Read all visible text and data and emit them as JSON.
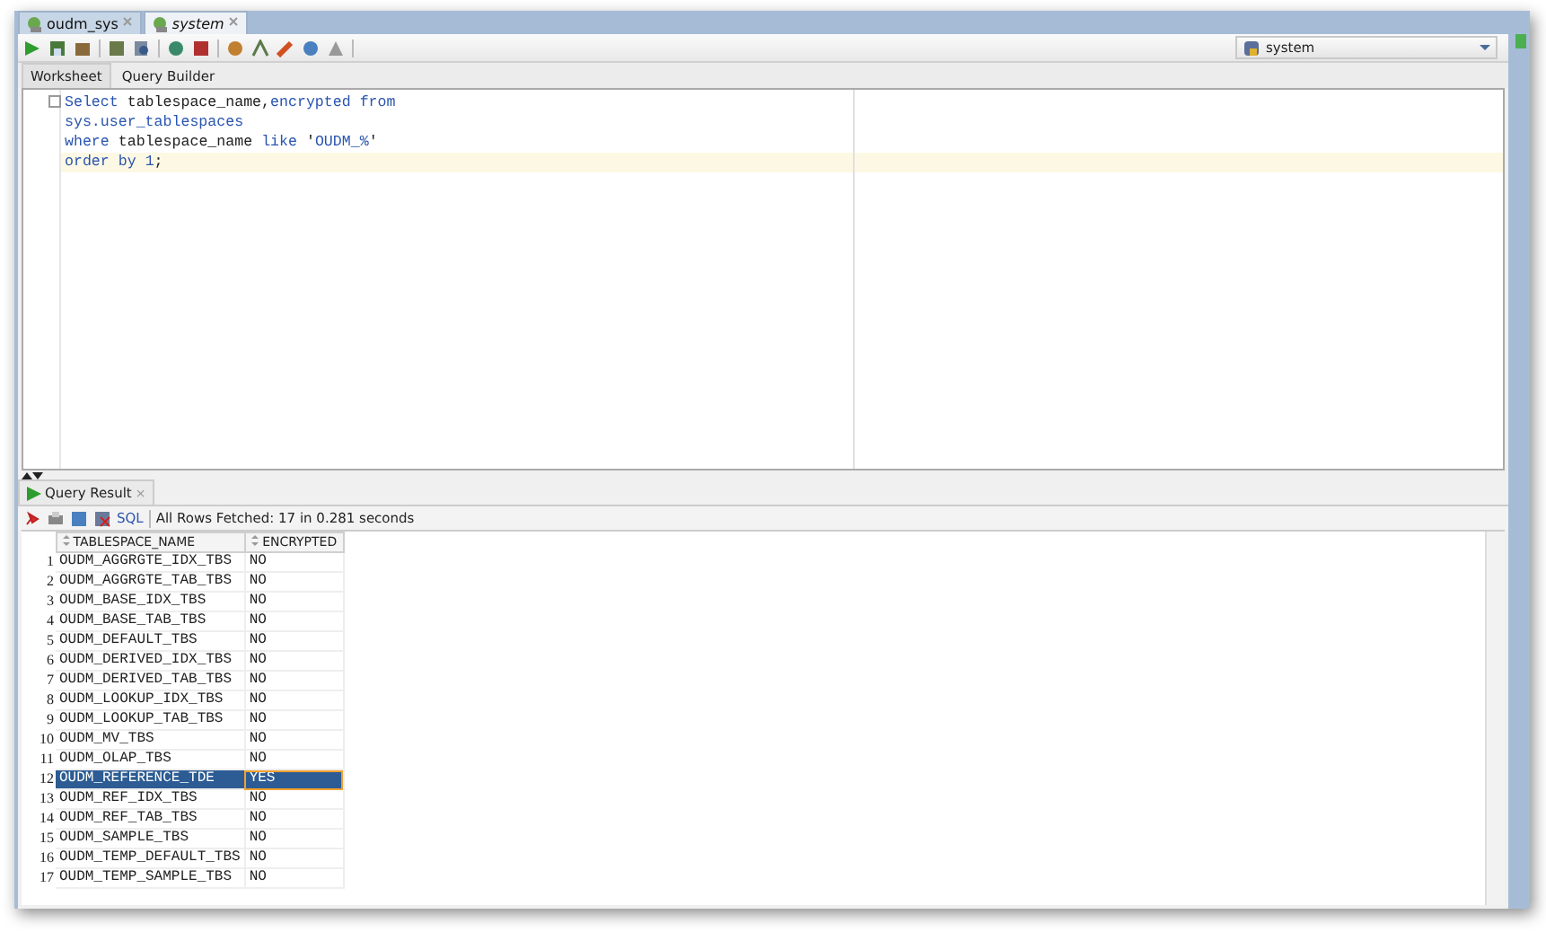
{
  "doc_tabs": [
    {
      "label": "oudm_sys",
      "selected": false
    },
    {
      "label": "system",
      "selected": true
    }
  ],
  "connection": {
    "value": "system"
  },
  "editor_tabs": [
    {
      "label": "Worksheet",
      "selected": true
    },
    {
      "label": "Query Builder",
      "selected": false
    }
  ],
  "code_lines": [
    {
      "current": false,
      "tokens": [
        {
          "kind": "keyword",
          "text": "Select"
        },
        {
          "kind": "plain",
          "text": " tablespace_name,"
        },
        {
          "kind": "keyword",
          "text": "encrypted from"
        }
      ]
    },
    {
      "current": false,
      "tokens": [
        {
          "kind": "keyword",
          "text": "sys.user_tablespaces"
        }
      ]
    },
    {
      "current": false,
      "tokens": [
        {
          "kind": "keyword",
          "text": "where"
        },
        {
          "kind": "plain",
          "text": " tablespace_name "
        },
        {
          "kind": "keyword",
          "text": "like"
        },
        {
          "kind": "plain",
          "text": " '"
        },
        {
          "kind": "string",
          "text": "OUDM_%"
        },
        {
          "kind": "plain",
          "text": "'"
        }
      ]
    },
    {
      "current": true,
      "tokens": [
        {
          "kind": "keyword",
          "text": "order by "
        },
        {
          "kind": "string",
          "text": "1"
        },
        {
          "kind": "plain",
          "text": ";"
        }
      ]
    }
  ],
  "result_tab": {
    "label": "Query Result",
    "close": "×"
  },
  "result_toolbar": {
    "sql_link": "SQL",
    "status": "All Rows Fetched: 17 in 0.281 seconds"
  },
  "table": {
    "columns": [
      "TABLESPACE_NAME",
      "ENCRYPTED"
    ],
    "rows": [
      {
        "num": "1",
        "cells": [
          "OUDM_AGGRGTE_IDX_TBS",
          "NO"
        ],
        "selected": false
      },
      {
        "num": "2",
        "cells": [
          "OUDM_AGGRGTE_TAB_TBS",
          "NO"
        ],
        "selected": false
      },
      {
        "num": "3",
        "cells": [
          "OUDM_BASE_IDX_TBS",
          "NO"
        ],
        "selected": false
      },
      {
        "num": "4",
        "cells": [
          "OUDM_BASE_TAB_TBS",
          "NO"
        ],
        "selected": false
      },
      {
        "num": "5",
        "cells": [
          "OUDM_DEFAULT_TBS",
          "NO"
        ],
        "selected": false
      },
      {
        "num": "6",
        "cells": [
          "OUDM_DERIVED_IDX_TBS",
          "NO"
        ],
        "selected": false
      },
      {
        "num": "7",
        "cells": [
          "OUDM_DERIVED_TAB_TBS",
          "NO"
        ],
        "selected": false
      },
      {
        "num": "8",
        "cells": [
          "OUDM_LOOKUP_IDX_TBS",
          "NO"
        ],
        "selected": false
      },
      {
        "num": "9",
        "cells": [
          "OUDM_LOOKUP_TAB_TBS",
          "NO"
        ],
        "selected": false
      },
      {
        "num": "10",
        "cells": [
          "OUDM_MV_TBS",
          "NO"
        ],
        "selected": false
      },
      {
        "num": "11",
        "cells": [
          "OUDM_OLAP_TBS",
          "NO"
        ],
        "selected": false
      },
      {
        "num": "12",
        "cells": [
          "OUDM_REFERENCE_TDE",
          "YES"
        ],
        "selected": true
      },
      {
        "num": "13",
        "cells": [
          "OUDM_REF_IDX_TBS",
          "NO"
        ],
        "selected": false
      },
      {
        "num": "14",
        "cells": [
          "OUDM_REF_TAB_TBS",
          "NO"
        ],
        "selected": false
      },
      {
        "num": "15",
        "cells": [
          "OUDM_SAMPLE_TBS",
          "NO"
        ],
        "selected": false
      },
      {
        "num": "16",
        "cells": [
          "OUDM_TEMP_DEFAULT_TBS",
          "NO"
        ],
        "selected": false
      },
      {
        "num": "17",
        "cells": [
          "OUDM_TEMP_SAMPLE_TBS",
          "NO"
        ],
        "selected": false
      }
    ]
  }
}
